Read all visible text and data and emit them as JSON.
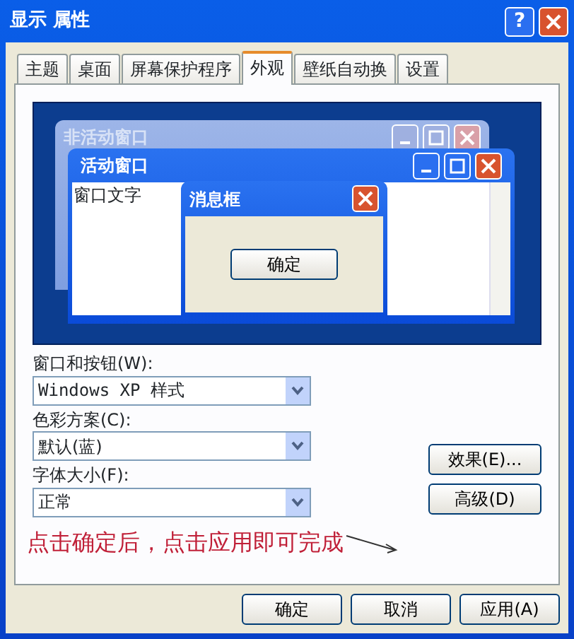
{
  "window": {
    "title": "显示 属性",
    "help_button": "?"
  },
  "tabs": [
    {
      "label": "主题",
      "selected": false
    },
    {
      "label": "桌面",
      "selected": false
    },
    {
      "label": "屏幕保护程序",
      "selected": false
    },
    {
      "label": "外观",
      "selected": true
    },
    {
      "label": "壁纸自动换",
      "selected": false
    },
    {
      "label": "设置",
      "selected": false
    }
  ],
  "preview": {
    "inactive_title": "非活动窗口",
    "active_title": "活动窗口",
    "window_text": "窗口文字",
    "message_title": "消息框",
    "message_button": "确定"
  },
  "fields": [
    {
      "label": "窗口和按钮(W):",
      "value": "Windows XP 样式"
    },
    {
      "label": "色彩方案(C):",
      "value": "默认(蓝)"
    },
    {
      "label": "字体大小(F):",
      "value": "正常"
    }
  ],
  "side_buttons": [
    "效果(E)...",
    "高级(D)"
  ],
  "annotation": "点击确定后，点击应用即可完成",
  "buttons": [
    "确定",
    "取消",
    "应用(A)"
  ]
}
